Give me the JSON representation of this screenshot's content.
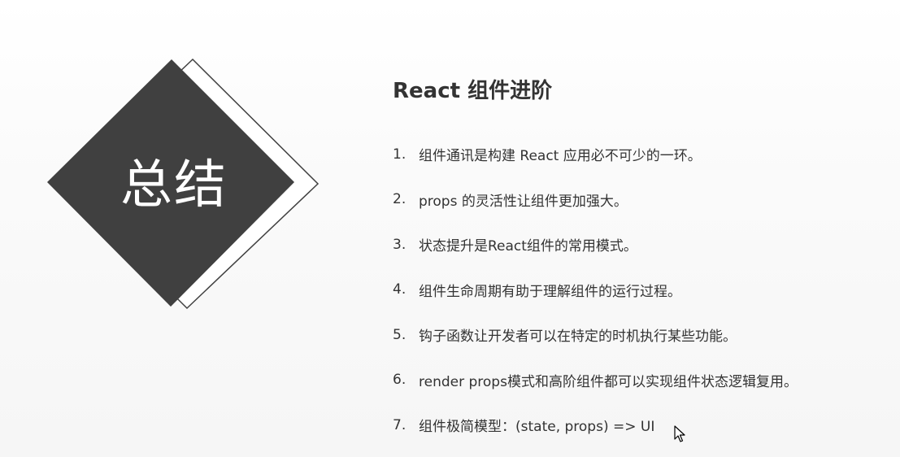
{
  "emblem": {
    "text": "总结"
  },
  "title": "React 组件进阶",
  "items": [
    {
      "num": "1.",
      "text": "组件通讯是构建 React 应用必不可少的一环。"
    },
    {
      "num": "2.",
      "text": "props 的灵活性让组件更加强大。"
    },
    {
      "num": "3.",
      "text": "状态提升是React组件的常用模式。"
    },
    {
      "num": "4.",
      "text": "组件生命周期有助于理解组件的运行过程。"
    },
    {
      "num": "5.",
      "text": "钩子函数让开发者可以在特定的时机执行某些功能。"
    },
    {
      "num": "6.",
      "text": "render props模式和高阶组件都可以实现组件状态逻辑复用。"
    },
    {
      "num": "7.",
      "text": "组件极简模型：(state, props) => UI"
    }
  ],
  "colors": {
    "diamond_fill": "#404040",
    "diamond_outline": "#404040",
    "text": "#333333"
  },
  "icons": {
    "pointer": "mouse-pointer-icon"
  }
}
